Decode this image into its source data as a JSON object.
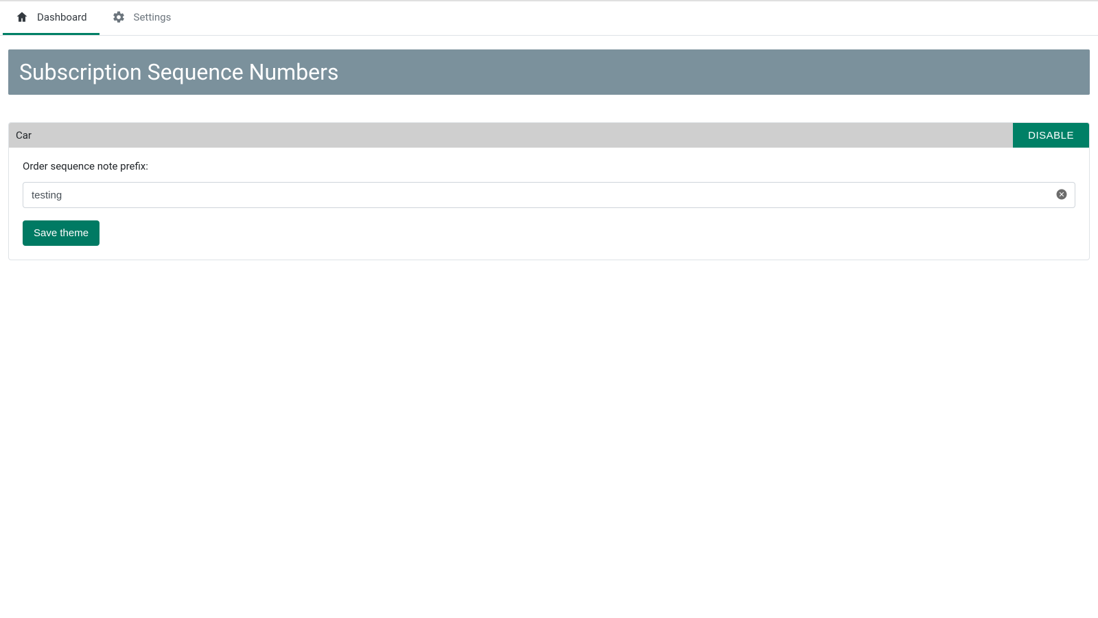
{
  "tabs": {
    "dashboard": {
      "label": "Dashboard",
      "active": true
    },
    "settings": {
      "label": "Settings",
      "active": false
    }
  },
  "page": {
    "title": "Subscription Sequence Numbers"
  },
  "item": {
    "name": "Car",
    "disable_label": "DISABLE",
    "prefix_label": "Order sequence note prefix:",
    "prefix_value": "testing",
    "save_label": "Save theme"
  },
  "colors": {
    "accent": "#008066",
    "banner": "#7b919c"
  }
}
